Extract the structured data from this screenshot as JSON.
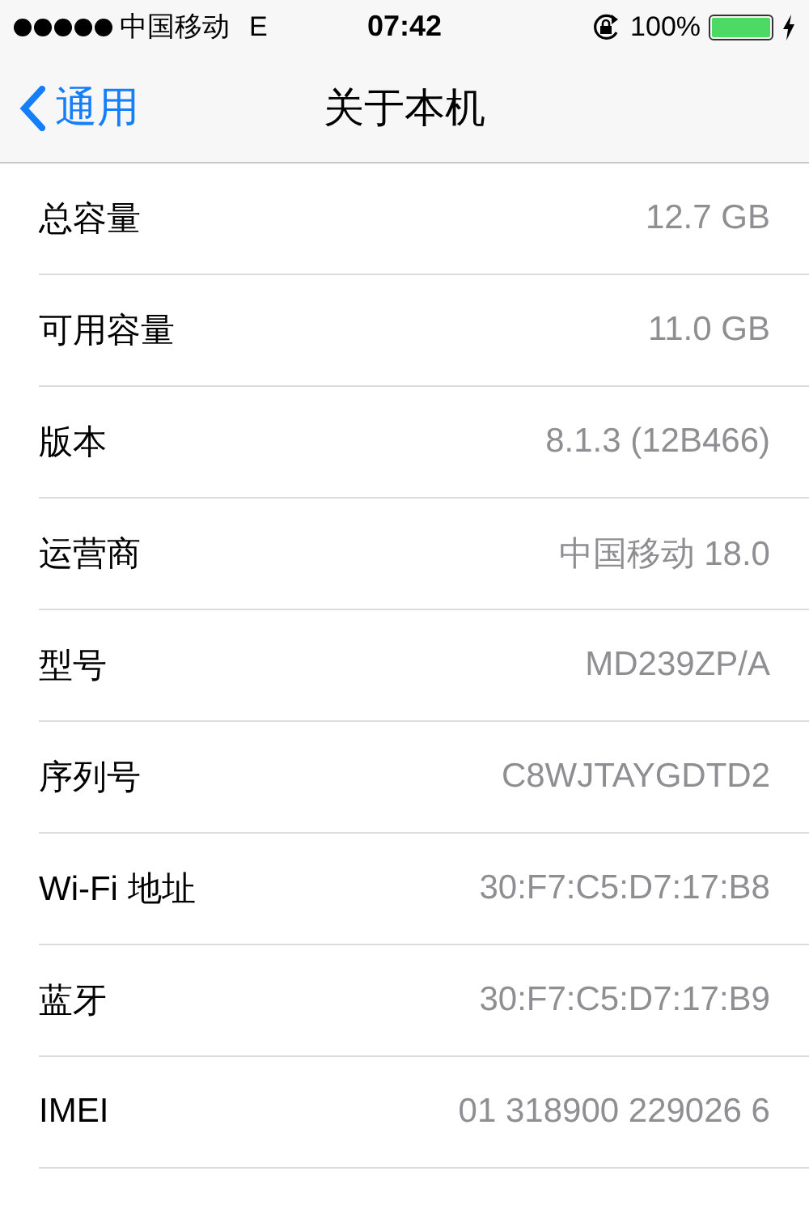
{
  "status_bar": {
    "carrier": "中国移动",
    "network": "E",
    "time": "07:42",
    "battery_percent": "100%",
    "battery": {
      "level": 1
    }
  },
  "nav_bar": {
    "back": "通用",
    "title": "关于本机"
  },
  "rows": [
    {
      "label": "总容量",
      "value": "12.7 GB"
    },
    {
      "label": "可用容量",
      "value": "11.0 GB"
    },
    {
      "label": "版本",
      "value": "8.1.3 (12B466)"
    },
    {
      "label": "运营商",
      "value": "中国移动 18.0"
    },
    {
      "label": "型号",
      "value": "MD239ZP/A"
    },
    {
      "label": "序列号",
      "value": "C8WJTAYGDTD2"
    },
    {
      "label": "Wi-Fi 地址",
      "value": "30:F7:C5:D7:17:B8"
    },
    {
      "label": "蓝牙",
      "value": "30:F7:C5:D7:17:B9"
    },
    {
      "label": "IMEI",
      "value": "01 318900 229026 6"
    }
  ]
}
